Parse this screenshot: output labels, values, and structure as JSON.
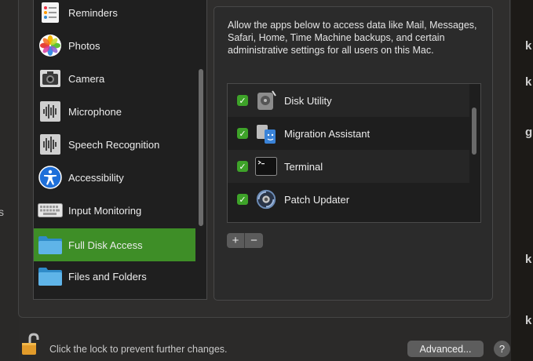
{
  "background_fragments": {
    "right": [
      "k",
      "k",
      "g",
      "k",
      "k"
    ],
    "left": "s"
  },
  "sidebar": {
    "items": [
      {
        "label": "Reminders",
        "icon": "reminders-icon",
        "selected": false
      },
      {
        "label": "Photos",
        "icon": "photos-icon",
        "selected": false
      },
      {
        "label": "Camera",
        "icon": "camera-icon",
        "selected": false
      },
      {
        "label": "Microphone",
        "icon": "microphone-icon",
        "selected": false
      },
      {
        "label": "Speech Recognition",
        "icon": "speech-recognition-icon",
        "selected": false
      },
      {
        "label": "Accessibility",
        "icon": "accessibility-icon",
        "selected": false
      },
      {
        "label": "Input Monitoring",
        "icon": "keyboard-icon",
        "selected": false
      },
      {
        "label": "Full Disk Access",
        "icon": "folder-icon",
        "selected": true
      },
      {
        "label": "Files and Folders",
        "icon": "folder-icon",
        "selected": false
      }
    ]
  },
  "detail": {
    "description": "Allow the apps below to access data like Mail, Messages, Safari, Home, Time Machine backups, and certain administrative settings for all users on this Mac.",
    "apps": [
      {
        "name": "Disk Utility",
        "checked": true,
        "icon": "disk-utility-icon"
      },
      {
        "name": "Migration Assistant",
        "checked": true,
        "icon": "migration-assistant-icon"
      },
      {
        "name": "Terminal",
        "checked": true,
        "icon": "terminal-icon"
      },
      {
        "name": "Patch Updater",
        "checked": true,
        "icon": "patch-updater-icon"
      }
    ],
    "add_label": "+",
    "remove_label": "−"
  },
  "footer": {
    "lock_text": "Click the lock to prevent further changes.",
    "advanced_label": "Advanced...",
    "help_label": "?"
  },
  "colors": {
    "accent_green": "#3e8e27",
    "checkbox_green": "#3ea329"
  }
}
